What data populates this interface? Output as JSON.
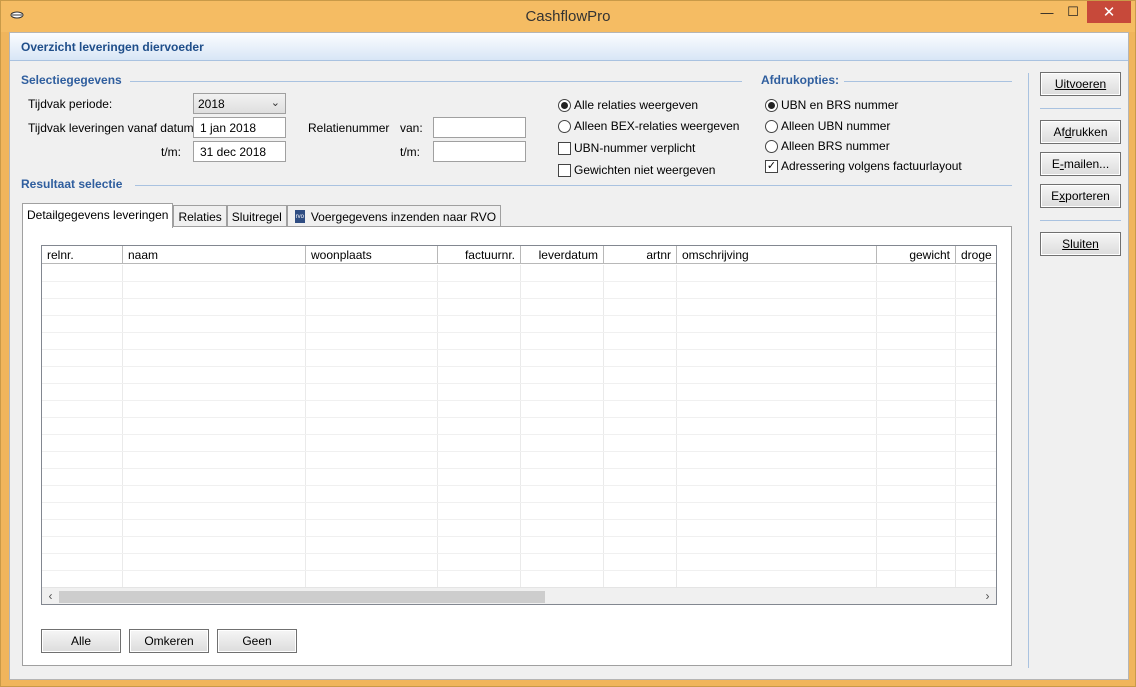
{
  "window": {
    "title": "CashflowPro",
    "minimize_glyph": "—",
    "maximize_glyph": "☐",
    "close_glyph": "✕"
  },
  "header": {
    "title": "Overzicht leveringen diervoeder"
  },
  "selection": {
    "section_title": "Selectiegegevens",
    "period_label": "Tijdvak periode:",
    "period_value": "2018",
    "from_date_label": "Tijdvak leveringen vanaf datum:",
    "from_date_value": "1 jan 2018",
    "to_label": "t/m:",
    "to_date_value": "31 dec 2018",
    "relation_label": "Relatienummer",
    "rel_from_label": "van:",
    "rel_from_value": "",
    "rel_to_label": "t/m:",
    "rel_to_value": "",
    "options": [
      {
        "label": "Alle relaties weergeven",
        "type": "radio",
        "checked": true
      },
      {
        "label": "Alleen BEX-relaties weergeven",
        "type": "radio",
        "checked": false
      },
      {
        "label": "UBN-nummer verplicht",
        "type": "checkbox",
        "checked": false
      },
      {
        "label": "Gewichten niet weergeven",
        "type": "checkbox",
        "checked": false
      }
    ]
  },
  "print_options": {
    "section_title": "Afdrukopties:",
    "options": [
      {
        "label": "UBN en BRS nummer",
        "type": "radio",
        "checked": true
      },
      {
        "label": "Alleen UBN nummer",
        "type": "radio",
        "checked": false
      },
      {
        "label": "Alleen BRS nummer",
        "type": "radio",
        "checked": false
      },
      {
        "label": "Adressering volgens factuurlayout",
        "type": "checkbox",
        "checked": true
      }
    ]
  },
  "result": {
    "section_title": "Resultaat selectie",
    "tabs": [
      {
        "label": "Detailgegevens leveringen",
        "active": true
      },
      {
        "label": "Relaties",
        "active": false
      },
      {
        "label": "Sluitregel",
        "active": false
      },
      {
        "label": "Voergegevens inzenden naar RVO",
        "active": false,
        "icon": "rvo-logo-icon"
      }
    ],
    "columns": [
      "relnr.",
      "naam",
      "woonplaats",
      "factuurnr.",
      "leverdatum",
      "artnr",
      "omschrijving",
      "gewicht",
      "droge"
    ],
    "scroll_left": "‹",
    "scroll_right": "›",
    "buttons": {
      "all": "Alle",
      "invert": "Omkeren",
      "none": "Geen"
    }
  },
  "side_buttons": {
    "execute": "Uitvoeren",
    "print_pre": "Af",
    "print_u": "d",
    "print_post": "rukken",
    "email_pre": "E",
    "email_u": "-",
    "email_post": "mailen...",
    "export_pre": "E",
    "export_u": "x",
    "export_post": "porteren",
    "close": "Sluiten"
  }
}
